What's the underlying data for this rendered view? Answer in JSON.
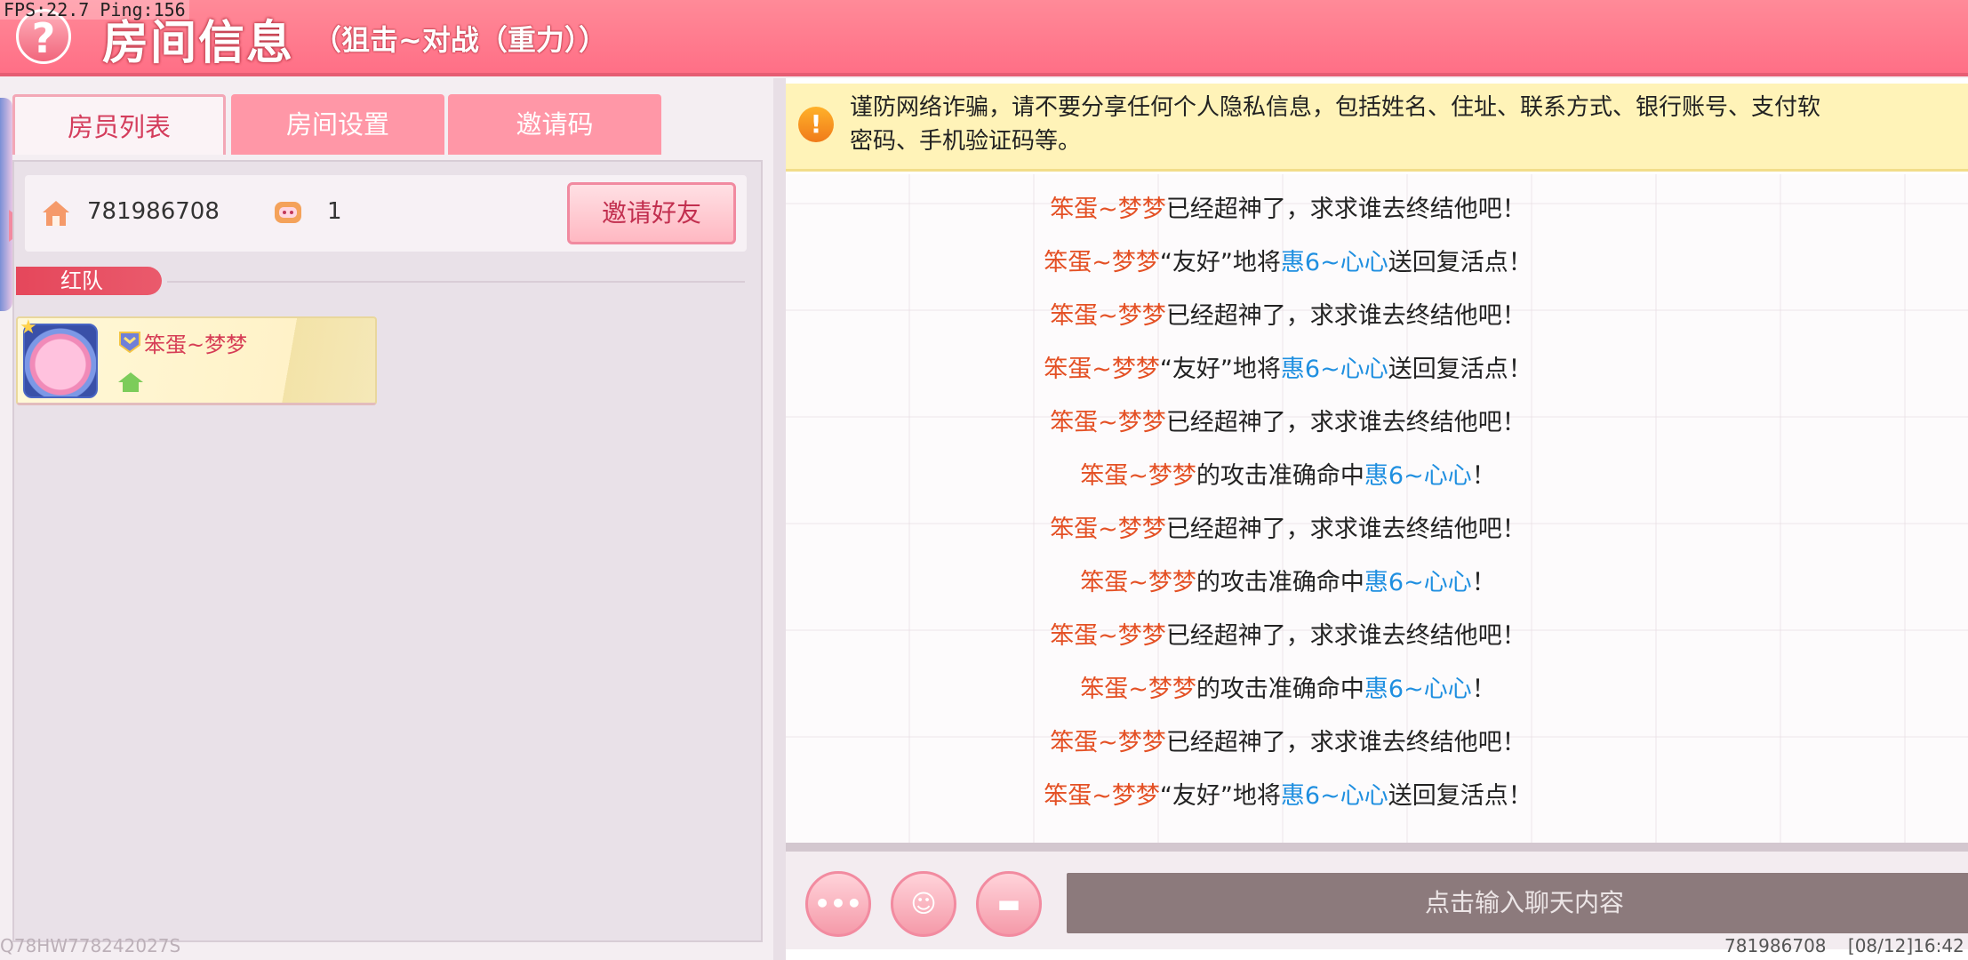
{
  "debug": {
    "fps_text": "FPS:22.7  Ping:156"
  },
  "header": {
    "help_icon_glyph": "?",
    "title": "房间信息",
    "subtitle": "（狙击~对战（重力））"
  },
  "tabs": [
    {
      "label": "房员列表",
      "active": true
    },
    {
      "label": "房间设置",
      "active": false
    },
    {
      "label": "邀请码",
      "active": false
    }
  ],
  "room": {
    "room_id": "781986708",
    "player_count": "1",
    "invite_button": "邀请好友"
  },
  "team": {
    "label": "红队"
  },
  "members": [
    {
      "name": "笨蛋~梦梦",
      "avatar": "avatar-icon",
      "is_host": true
    }
  ],
  "bottom_code": "Q78HW778242027S",
  "notice": {
    "icon": "!",
    "text": "谨防网络诈骗，请不要分享任何个人隐私信息，包括姓名、住址、联系方式、银行账号、支付软\n密码、手机验证码等。"
  },
  "chat": {
    "messages": [
      {
        "parts": [
          {
            "t": "笨蛋~梦梦",
            "c": "red"
          },
          {
            "t": "已经超神了，求求谁去终结他吧！",
            "c": "black"
          }
        ]
      },
      {
        "parts": [
          {
            "t": "笨蛋~梦梦",
            "c": "red"
          },
          {
            "t": "“友好”地将",
            "c": "black"
          },
          {
            "t": "惠6~心心",
            "c": "blue"
          },
          {
            "t": "送回复活点！",
            "c": "black"
          }
        ]
      },
      {
        "parts": [
          {
            "t": "笨蛋~梦梦",
            "c": "red"
          },
          {
            "t": "已经超神了，求求谁去终结他吧！",
            "c": "black"
          }
        ]
      },
      {
        "parts": [
          {
            "t": "笨蛋~梦梦",
            "c": "red"
          },
          {
            "t": "“友好”地将",
            "c": "black"
          },
          {
            "t": "惠6~心心",
            "c": "blue"
          },
          {
            "t": "送回复活点！",
            "c": "black"
          }
        ]
      },
      {
        "parts": [
          {
            "t": "笨蛋~梦梦",
            "c": "red"
          },
          {
            "t": "已经超神了，求求谁去终结他吧！",
            "c": "black"
          }
        ]
      },
      {
        "parts": [
          {
            "t": "笨蛋~梦梦",
            "c": "red"
          },
          {
            "t": "的攻击准确命中",
            "c": "black"
          },
          {
            "t": "惠6~心心",
            "c": "blue"
          },
          {
            "t": "！",
            "c": "black"
          }
        ]
      },
      {
        "parts": [
          {
            "t": "笨蛋~梦梦",
            "c": "red"
          },
          {
            "t": "已经超神了，求求谁去终结他吧！",
            "c": "black"
          }
        ]
      },
      {
        "parts": [
          {
            "t": "笨蛋~梦梦",
            "c": "red"
          },
          {
            "t": "的攻击准确命中",
            "c": "black"
          },
          {
            "t": "惠6~心心",
            "c": "blue"
          },
          {
            "t": "！",
            "c": "black"
          }
        ]
      },
      {
        "parts": [
          {
            "t": "笨蛋~梦梦",
            "c": "red"
          },
          {
            "t": "已经超神了，求求谁去终结他吧！",
            "c": "black"
          }
        ]
      },
      {
        "parts": [
          {
            "t": "笨蛋~梦梦",
            "c": "red"
          },
          {
            "t": "的攻击准确命中",
            "c": "black"
          },
          {
            "t": "惠6~心心",
            "c": "blue"
          },
          {
            "t": "！",
            "c": "black"
          }
        ]
      },
      {
        "parts": [
          {
            "t": "笨蛋~梦梦",
            "c": "red"
          },
          {
            "t": "已经超神了，求求谁去终结他吧！",
            "c": "black"
          }
        ]
      },
      {
        "parts": [
          {
            "t": "笨蛋~梦梦",
            "c": "red"
          },
          {
            "t": "“友好”地将",
            "c": "black"
          },
          {
            "t": "惠6~心心",
            "c": "blue"
          },
          {
            "t": "送回复活点！",
            "c": "black"
          }
        ]
      }
    ],
    "buttons": [
      {
        "name": "more-icon",
        "glyph": "•••"
      },
      {
        "name": "emoji-icon",
        "glyph": "☺"
      },
      {
        "name": "keyboard-icon",
        "glyph": "▬"
      }
    ],
    "input_placeholder": "点击输入聊天内容"
  },
  "footer": {
    "room_id": "781986708",
    "timestamp": "[08/12]16:42"
  },
  "colors": {
    "accent": "#ff6f86",
    "name_red": "#e45024",
    "name_blue": "#1f8fe0",
    "notice_bg": "#fff3b8"
  }
}
